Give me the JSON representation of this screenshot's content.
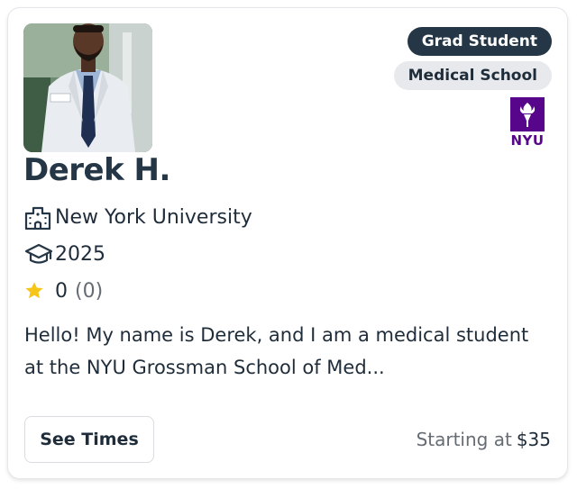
{
  "tutor": {
    "name": "Derek H.",
    "school": "New York University",
    "year": "2025",
    "rating": "0",
    "rating_count": "(0)",
    "bio": "Hello! My name is Derek, and I am a medical student at the NYU Grossman School of Med..."
  },
  "badges": {
    "level": "Grad Student",
    "program": "Medical School"
  },
  "logo": {
    "text": "NYU",
    "color": "#57068c"
  },
  "actions": {
    "see_times_label": "See Times"
  },
  "pricing": {
    "prefix": "Starting at",
    "amount": "$35"
  },
  "icons": {
    "school": "building-icon",
    "year": "graduation-cap-icon",
    "rating": "star-icon"
  },
  "colors": {
    "navy": "#253746",
    "star": "#f5c518",
    "nyu_purple": "#57068c",
    "muted": "#666c74"
  }
}
